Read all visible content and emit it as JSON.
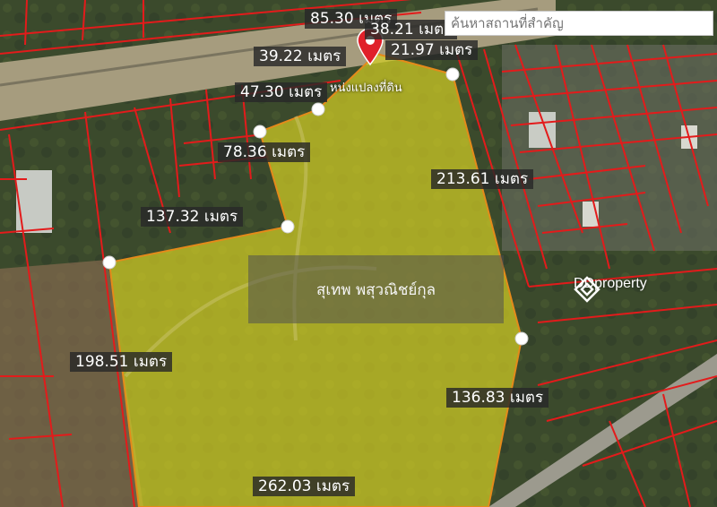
{
  "search": {
    "placeholder": "ค้นหาสถานที่สำคัญ"
  },
  "parcel": {
    "owner": "สุเทพ พสุวณิชย์กุล",
    "name": "หน่งแปลงที่ดิน",
    "fill_color": "#d6d024",
    "boundary_color": "#e31b1b"
  },
  "measurements": [
    "85.30 เมตร",
    "38.21 เมตร",
    "21.97 เมตร",
    "39.22 เมตร",
    "47.30 เมตร",
    "78.36 เมตร",
    "213.61 เมตร",
    "137.32 เมตร",
    "198.51 เมตร",
    "136.83 เมตร",
    "262.03 เมตร"
  ],
  "watermark": {
    "text": "DDproperty",
    "icon": "ddproperty-logo-icon"
  },
  "marker": {
    "icon": "map-pin-icon",
    "color": "#e0202a"
  }
}
